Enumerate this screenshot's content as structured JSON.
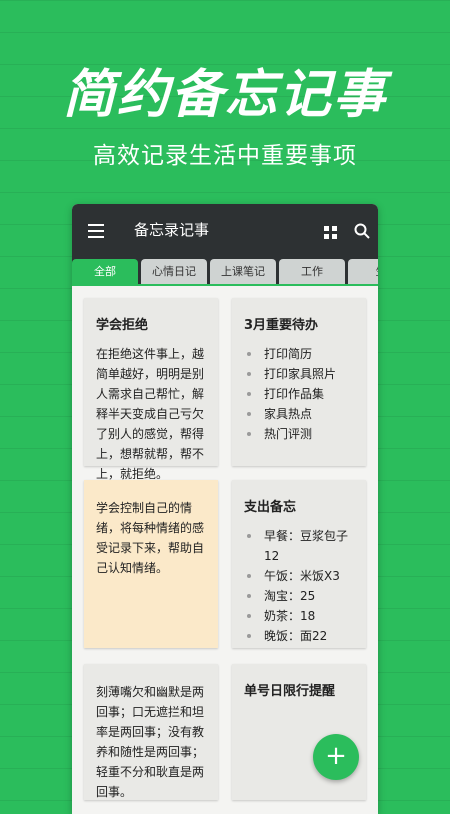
{
  "promo": {
    "title": "简约备忘记事",
    "subtitle": "高效记录生活中重要事项"
  },
  "app": {
    "title": "备忘录记事",
    "icons": {
      "menu": "hamburger-menu-icon",
      "view": "grid-view-icon",
      "search": "search-icon",
      "add": "plus-icon"
    }
  },
  "tabs": [
    "全部",
    "心情日记",
    "上课笔记",
    "工作",
    "生"
  ],
  "active_tab": "全部",
  "colors": {
    "accent": "#2bbd5c",
    "appbar": "#2d3133",
    "card": "#e9e9e6",
    "card_yellow": "#fbe9c9"
  },
  "notes": [
    {
      "title": "学会拒绝",
      "body": "在拒绝这件事上，越简单越好，明明是别人需求自己帮忙，解释半天变成自己亏欠了别人的感觉，帮得上，想帮就帮，帮不上，就拒绝。"
    },
    {
      "title": "3月重要待办",
      "items": [
        "打印简历",
        "打印家具照片",
        "打印作品集",
        "家具热点",
        "热门评测"
      ]
    },
    {
      "title": "",
      "body": "学会控制自己的情绪，将每种情绪的感受记录下来，帮助自己认知情绪。"
    },
    {
      "title": "支出备忘",
      "items": [
        "早餐：豆浆包子12",
        "午饭：米饭X3",
        "淘宝：25",
        "奶茶：18",
        "晚饭：面22"
      ]
    },
    {
      "title": "",
      "body": "刻薄嘴欠和幽默是两回事；口无遮拦和坦率是两回事；没有教养和随性是两回事；轻重不分和耿直是两回事。"
    },
    {
      "title": "单号日限行提醒",
      "body": ""
    }
  ],
  "fab_label": "+"
}
